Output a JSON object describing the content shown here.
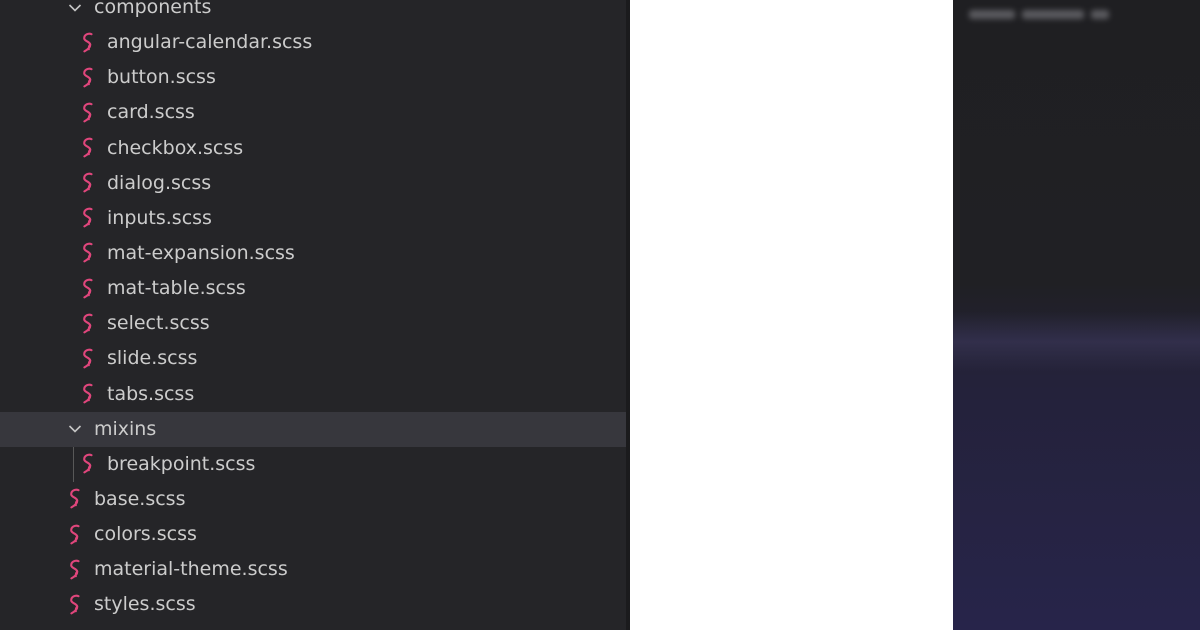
{
  "explorer": {
    "folders": {
      "components": {
        "name": "components",
        "expanded": true,
        "files": [
          "angular-calendar.scss",
          "button.scss",
          "card.scss",
          "checkbox.scss",
          "dialog.scss",
          "inputs.scss",
          "mat-expansion.scss",
          "mat-table.scss",
          "select.scss",
          "slide.scss",
          "tabs.scss"
        ]
      },
      "mixins": {
        "name": "mixins",
        "expanded": true,
        "selected": true,
        "files": [
          "breakpoint.scss"
        ]
      }
    },
    "root_files": [
      "base.scss",
      "colors.scss",
      "material-theme.scss",
      "styles.scss"
    ],
    "icons": {
      "folder_chevron": "chevron-down-icon",
      "file_icon": "sass-icon"
    },
    "colors": {
      "sidebar_bg": "#252528",
      "selected_row_bg": "#37373d",
      "text": "#cccccc",
      "sass_icon": "#e0467c"
    }
  }
}
